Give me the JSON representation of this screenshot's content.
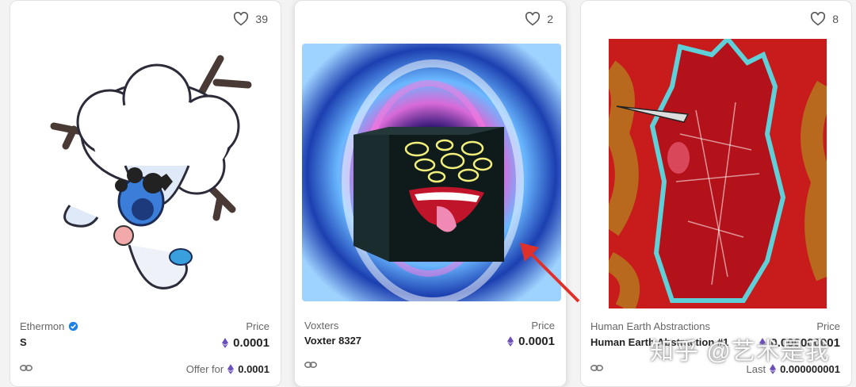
{
  "cards": [
    {
      "favorites": "39",
      "collection": "Ethermon",
      "name": "S",
      "price_label": "Price",
      "price": "0.0001",
      "sub_label": "Offer for",
      "sub_value": "0.0001",
      "verified": true
    },
    {
      "favorites": "2",
      "collection": "Voxters",
      "name": "Voxter 8327",
      "price_label": "Price",
      "price": "0.0001"
    },
    {
      "favorites": "8",
      "collection": "Human Earth Abstractions",
      "name": "Human Earth Abstraction #1",
      "price_label": "Price",
      "price": "0.000000001",
      "sub_label": "Last",
      "sub_value": "0.000000001"
    }
  ],
  "watermark": "知乎 @艺术是我",
  "colors": {
    "eth": "#6b4fbb",
    "verified": "#2081e2",
    "annotation_arrow": "#e0302a"
  },
  "icons": [
    "heart-icon",
    "eth-icon",
    "verified-icon",
    "link-icon"
  ]
}
